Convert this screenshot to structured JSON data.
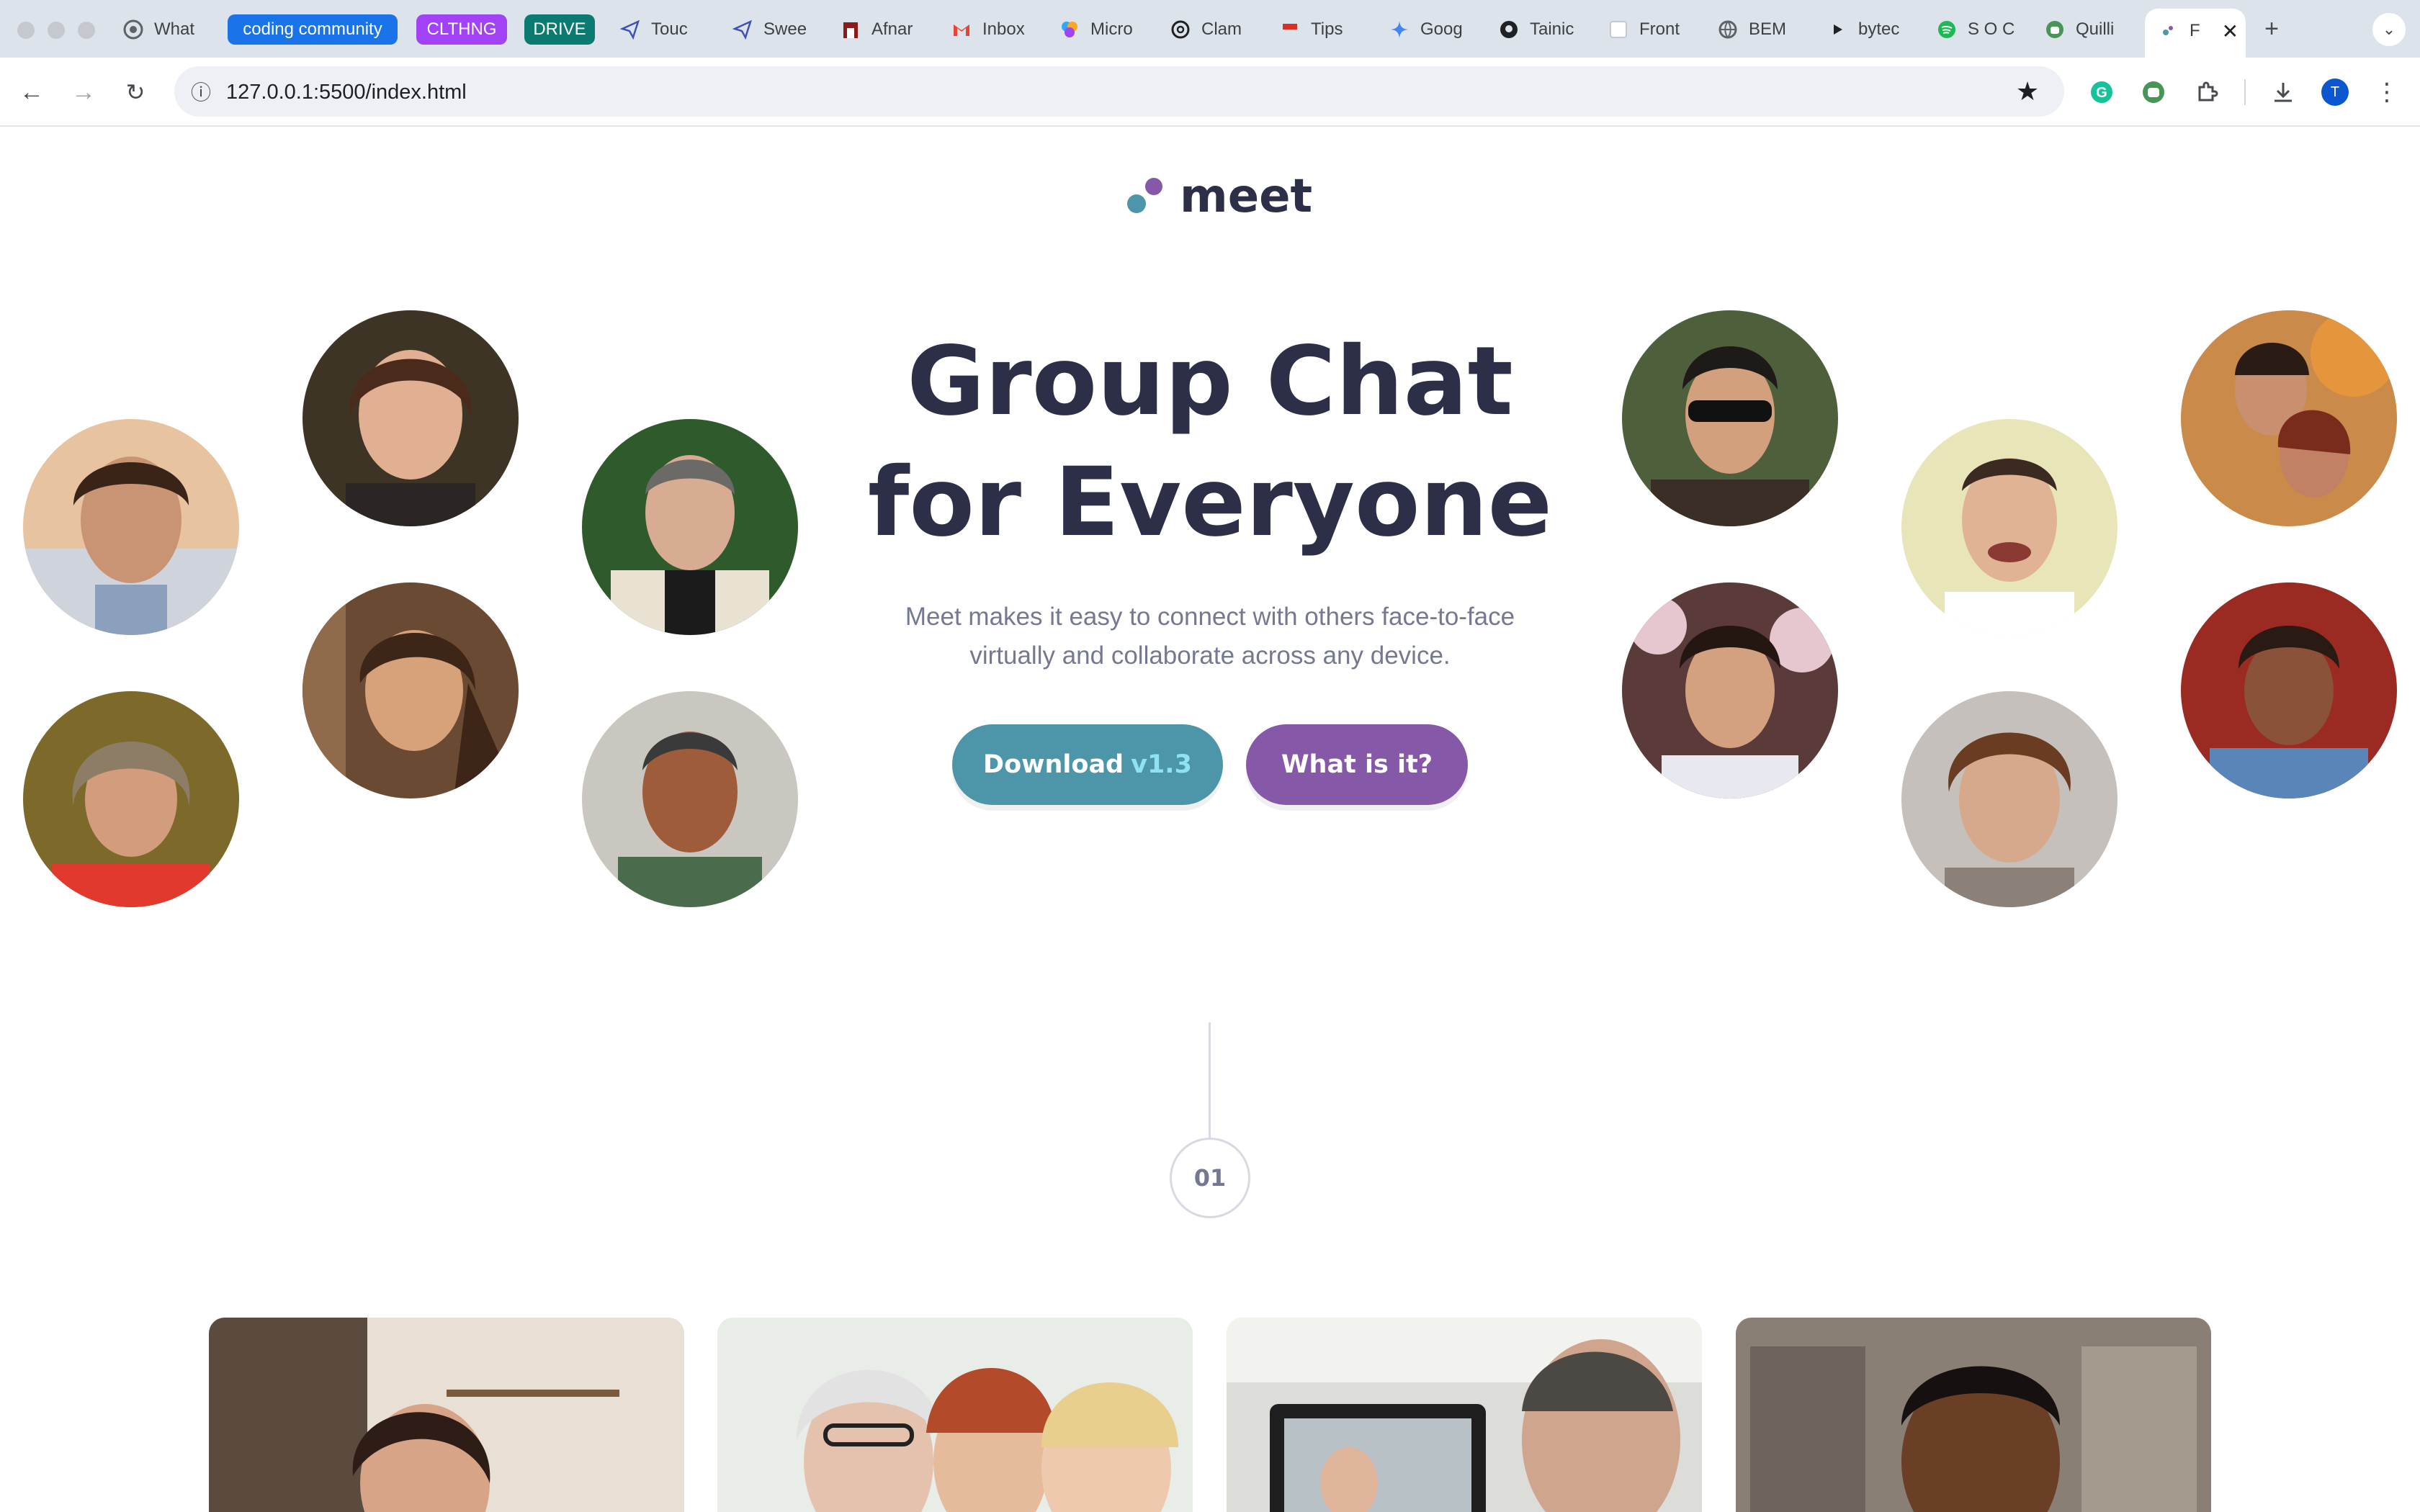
{
  "browser": {
    "tabs": [
      {
        "label": "What",
        "icon": "chrome-icon"
      },
      {
        "label": "coding community",
        "group": true,
        "color": "#1a73e8"
      },
      {
        "label": "CLTHNG",
        "group": true,
        "color": "#a142f4"
      },
      {
        "label": "DRIVE",
        "group": true,
        "color": "#0b7a70"
      },
      {
        "label": "Touc",
        "icon": "paper-plane-icon"
      },
      {
        "label": "Swee",
        "icon": "paper-plane-icon"
      },
      {
        "label": "Afnar",
        "icon": "fortress-icon"
      },
      {
        "label": "Inbox",
        "icon": "gmail-icon"
      },
      {
        "label": "Micro",
        "icon": "copilot-icon"
      },
      {
        "label": "Clam",
        "icon": "openai-icon"
      },
      {
        "label": "Tips",
        "icon": "zalo-icon"
      },
      {
        "label": "Goog",
        "icon": "gemini-icon"
      },
      {
        "label": "Tainic",
        "icon": "github-icon"
      },
      {
        "label": "Front",
        "icon": "frontend-icon"
      },
      {
        "label": "BEM",
        "icon": "globe-icon"
      },
      {
        "label": "bytec",
        "icon": "play-icon"
      },
      {
        "label": "S O C",
        "icon": "spotify-icon"
      },
      {
        "label": "Quilli",
        "icon": "quillbot-icon"
      },
      {
        "label": "F",
        "icon": "page-icon",
        "active": true
      }
    ],
    "url": "127.0.0.1:5500/index.html",
    "profile_initial": "T"
  },
  "page": {
    "logo": "meet",
    "hero_title_line1": "Group Chat",
    "hero_title_line2": "for Everyone",
    "hero_subtitle": "Meet makes it easy to connect with others face-to-face virtually and collaborate across any device.",
    "download_label": "Download",
    "download_version": "v1.3",
    "what_label": "What is it?",
    "step_number": "01"
  },
  "colors": {
    "heading": "#2d2f48",
    "body_text": "#757891",
    "teal": "#4d96a9",
    "purple": "#8558a8",
    "cyan_accent": "#8fe2f3"
  }
}
